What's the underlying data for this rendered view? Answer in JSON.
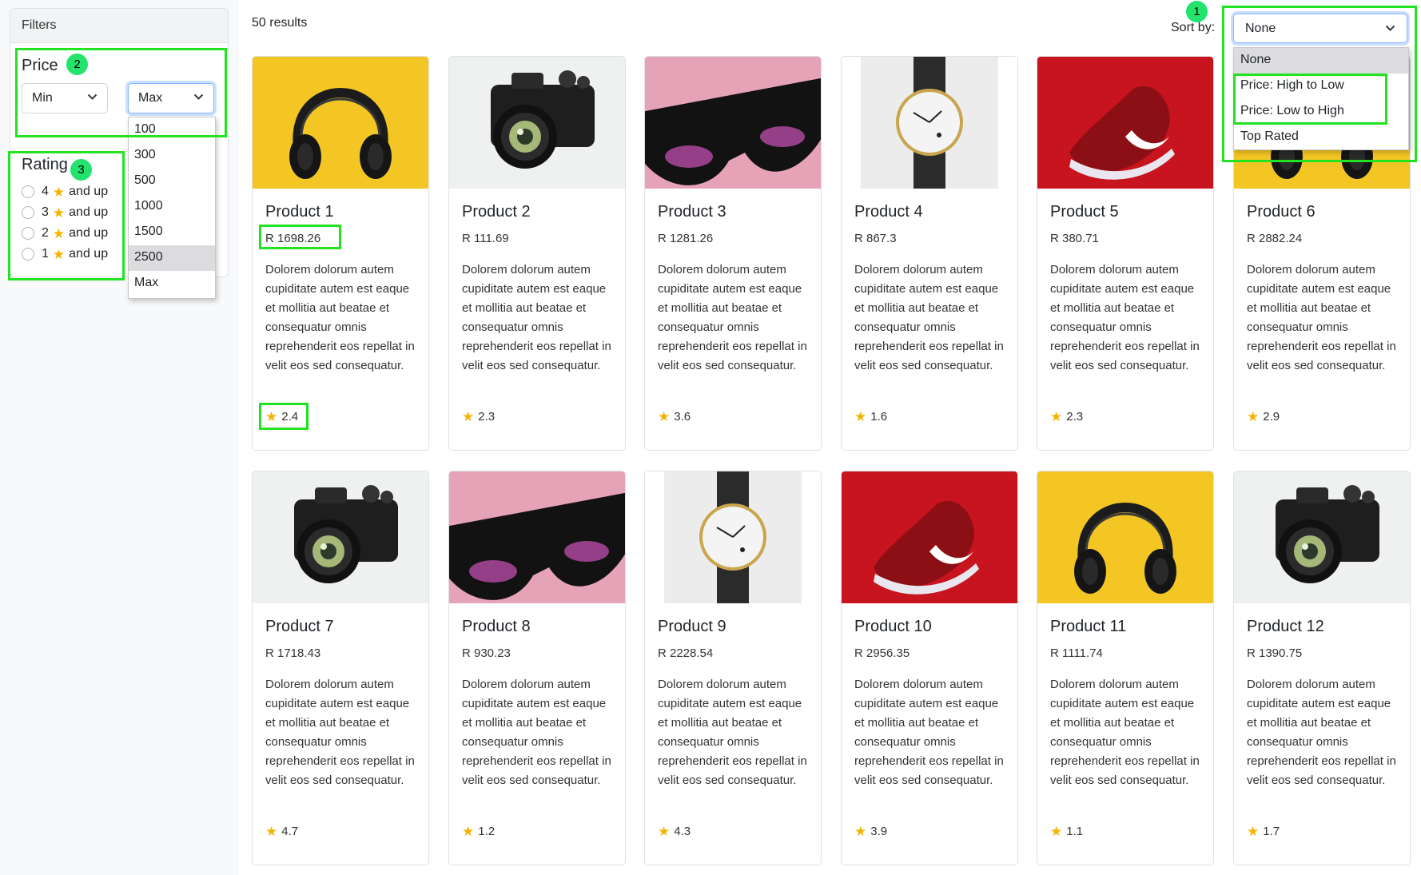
{
  "filters": {
    "header": "Filters",
    "price_title": "Price",
    "min_select": {
      "value": "Min"
    },
    "max_select": {
      "value": "Max",
      "options": [
        "100",
        "300",
        "500",
        "1000",
        "1500",
        "2500",
        "Max"
      ],
      "highlighted": "2500"
    },
    "rating_title": "Rating",
    "rating_options": [
      {
        "value": "4",
        "suffix": "and up"
      },
      {
        "value": "3",
        "suffix": "and up"
      },
      {
        "value": "2",
        "suffix": "and up"
      },
      {
        "value": "1",
        "suffix": "and up"
      }
    ]
  },
  "results": {
    "count_label": "50 results"
  },
  "sort": {
    "label": "Sort by:",
    "value": "None",
    "options": [
      "None",
      "Price: High to Low",
      "Price: Low to High",
      "Top Rated"
    ]
  },
  "products": [
    {
      "title": "Product 1",
      "price": "R 1698.26",
      "rating": "2.4",
      "image": "headphones"
    },
    {
      "title": "Product 2",
      "price": "R 111.69",
      "rating": "2.3",
      "image": "camera"
    },
    {
      "title": "Product 3",
      "price": "R 1281.26",
      "rating": "3.6",
      "image": "sunglasses"
    },
    {
      "title": "Product 4",
      "price": "R 867.3",
      "rating": "1.6",
      "image": "watch"
    },
    {
      "title": "Product 5",
      "price": "R 380.71",
      "rating": "2.3",
      "image": "sneaker"
    },
    {
      "title": "Product 6",
      "price": "R 2882.24",
      "rating": "2.9",
      "image": "headphones"
    },
    {
      "title": "Product 7",
      "price": "R 1718.43",
      "rating": "4.7",
      "image": "camera"
    },
    {
      "title": "Product 8",
      "price": "R 930.23",
      "rating": "1.2",
      "image": "sunglasses"
    },
    {
      "title": "Product 9",
      "price": "R 2228.54",
      "rating": "4.3",
      "image": "watch"
    },
    {
      "title": "Product 10",
      "price": "R 2956.35",
      "rating": "3.9",
      "image": "sneaker"
    },
    {
      "title": "Product 11",
      "price": "R 1111.74",
      "rating": "1.1",
      "image": "headphones"
    },
    {
      "title": "Product 12",
      "price": "R 1390.75",
      "rating": "1.7",
      "image": "camera"
    }
  ],
  "product_description": "Dolorem dolorum autem cupiditate autem est eaque et mollitia aut beatae et consequatur omnis reprehenderit eos repellat in velit eos sed consequatur.",
  "annotations": [
    "1",
    "2",
    "3"
  ],
  "colors": {
    "star": "#f5b301",
    "annotation": "#22e322",
    "annotation_badge": "#22e36b"
  }
}
